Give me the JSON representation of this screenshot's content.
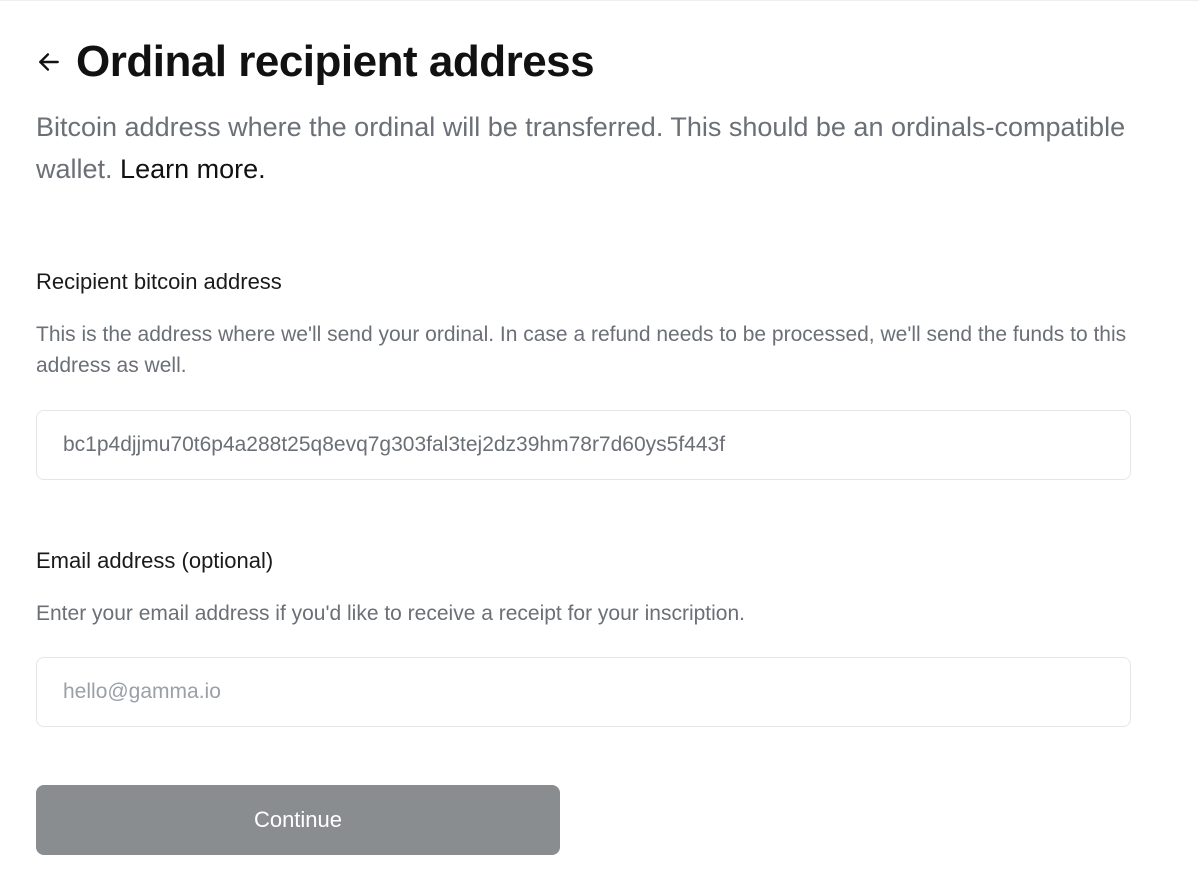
{
  "header": {
    "title": "Ordinal recipient address",
    "subtitle_prefix": "Bitcoin address where the ordinal will be transferred. This should be an ordinals-compatible wallet. ",
    "learn_more": "Learn more."
  },
  "recipient_section": {
    "label": "Recipient bitcoin address",
    "description": "This is the address where we'll send your ordinal. In case a refund needs to be processed, we'll send the funds to this address as well.",
    "value": "bc1p4djjmu70t6p4a288t25q8evq7g303fal3tej2dz39hm78r7d60ys5f443f"
  },
  "email_section": {
    "label": "Email address (optional)",
    "description": "Enter your email address if you'd like to receive a receipt for your inscription.",
    "placeholder": "hello@gamma.io",
    "value": ""
  },
  "actions": {
    "continue": "Continue"
  },
  "colors": {
    "text": "#111111",
    "muted": "#6b6f76",
    "border": "#e5e6e8",
    "button_bg": "#8a8d90",
    "button_text": "#ffffff"
  }
}
